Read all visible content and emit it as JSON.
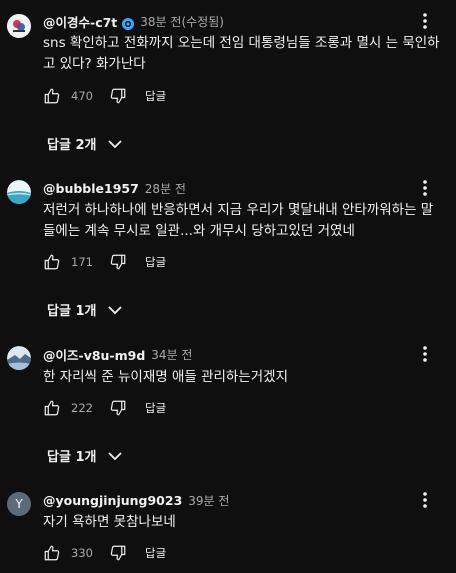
{
  "comments": [
    {
      "author": "@이경수-c7t",
      "verified": true,
      "time": "38분 전(수정됨)",
      "text": "sns 확인하고 전화까지 오는데 전임 대통령님들 조롱과 멸시 는 묵인하고 있다? 화가난다",
      "likes": "470",
      "reply_label": "답글",
      "replies_label": "답글 2개",
      "avatar_colors": [
        "#f2f2f2",
        "#d9364b",
        "#2f5aa8"
      ]
    },
    {
      "author": "@bubble1957",
      "verified": false,
      "time": "28분 전",
      "text": "저런거 하나하나에 반응하면서 지금 우리가 몇달내내 안타까워하는 말들에는 계속 무시로 일관...와 개무시 당하고있던 거였네",
      "likes": "171",
      "reply_label": "답글",
      "replies_label": "답글 1개",
      "avatar_colors": [
        "#bfe5f2",
        "#3aa6c4",
        "#e9f6fb"
      ]
    },
    {
      "author": "@이즈-v8u-m9d",
      "verified": false,
      "time": "34분 전",
      "text": "한 자리씩 준 뉴이재명 애들 관리하는거겠지",
      "likes": "222",
      "reply_label": "답글",
      "replies_label": "답글 1개",
      "avatar_colors": [
        "#a9c0d8",
        "#4e6b8c",
        "#dfe8f0"
      ]
    },
    {
      "author": "@youngjinjung9023",
      "verified": false,
      "time": "39분 전",
      "text": "자기 욕하면 못참나보네",
      "likes": "330",
      "reply_label": "답글",
      "avatar_letter": "Y",
      "avatar_colors": [
        "#5c6b7a"
      ]
    }
  ],
  "icons": {
    "like": "thumbs-up-icon",
    "dislike": "thumbs-down-icon",
    "menu": "more-vert-icon",
    "chevron": "chevron-down-icon",
    "verified": "verified-badge-icon"
  }
}
